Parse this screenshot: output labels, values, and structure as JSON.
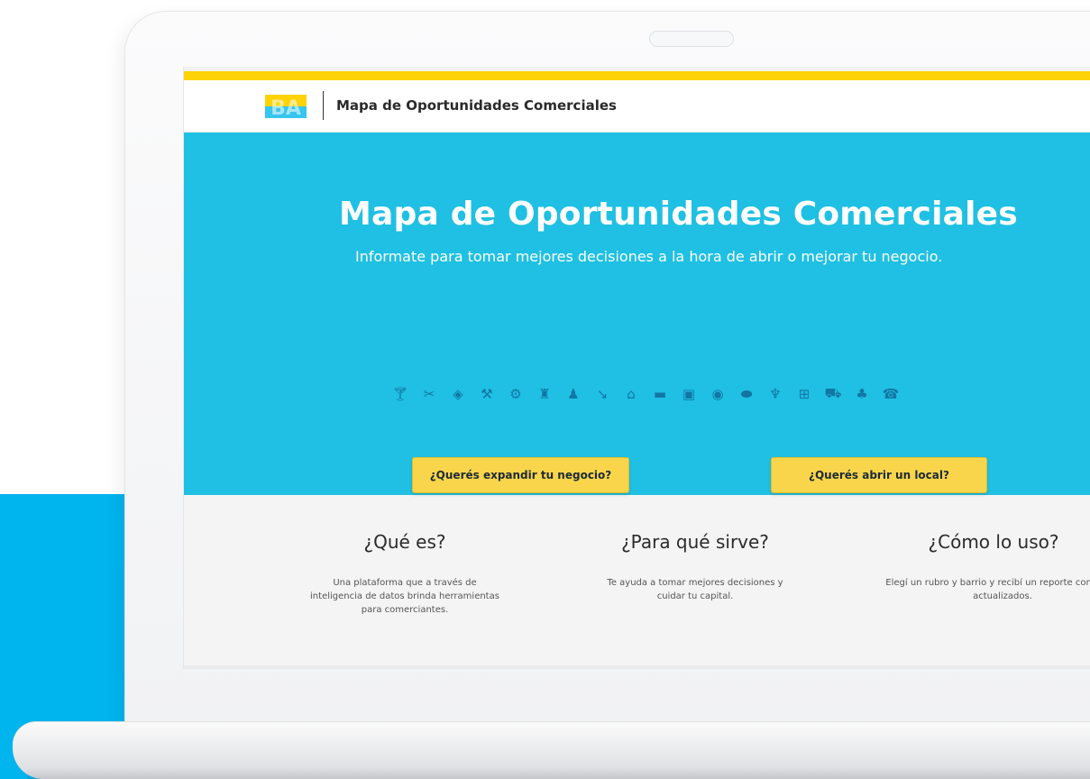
{
  "header": {
    "logo_text": "BA",
    "site_title": "Mapa de Oportunidades Comerciales"
  },
  "hero": {
    "title": "Mapa de Oportunidades Comerciales",
    "subtitle": "Informate para tomar mejores decisiones a la hora de abrir o mejorar tu negocio.",
    "category_icons": [
      "cocktail-icon",
      "hair-salon-icon",
      "jewelry-icon",
      "tools-icon",
      "bicycle-icon",
      "lamp-icon",
      "clothing-icon",
      "hardware-icon",
      "home-icon",
      "appliance-icon",
      "bookstore-icon",
      "optics-icon",
      "pharmacy-icon",
      "restaurant-icon",
      "medical-icon",
      "supermarket-icon",
      "plant-icon",
      "phone-icon"
    ],
    "btn_expand": "¿Querés expandir tu negocio?",
    "btn_open": "¿Querés abrir un local?"
  },
  "info": {
    "what_title": "¿Qué es?",
    "what_text": "Una plataforma que a través de inteligencia de datos brinda herramientas para comerciantes.",
    "purpose_title": "¿Para qué sirve?",
    "purpose_text": "Te ayuda a tomar mejores decisiones y cuidar tu capital.",
    "howto_title": "¿Cómo lo uso?",
    "howto_text": "Elegí un rubro y barrio y recibí un reporte con datos actualizados."
  },
  "colors": {
    "accent_blue": "#00b4ee",
    "hero_cyan": "#1fc0e3",
    "brand_yellow": "#fdd306",
    "button_yellow": "#f8d54a",
    "icon_blue": "#1276a5"
  }
}
